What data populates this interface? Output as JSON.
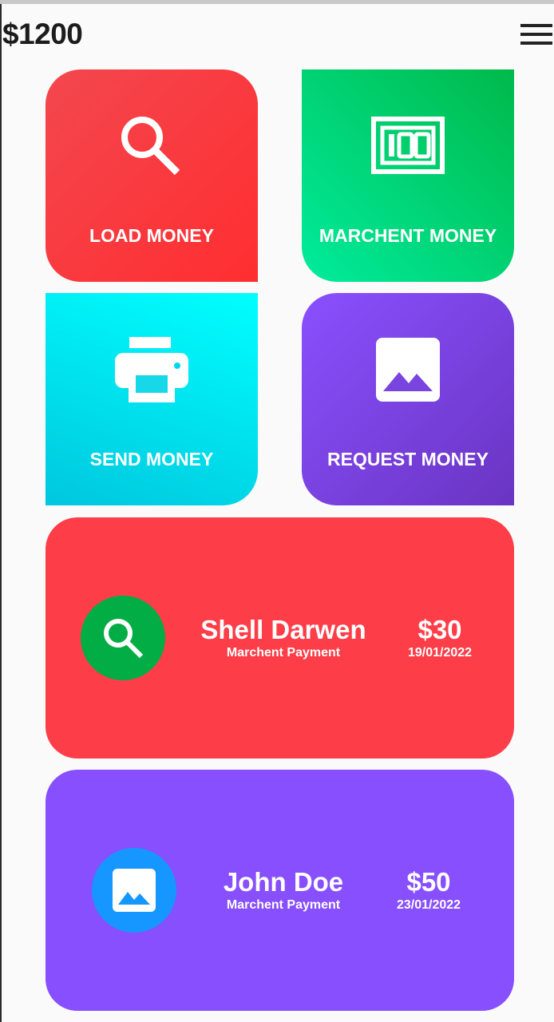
{
  "header": {
    "balance": "$1200",
    "menu_icon": "hamburger-menu-icon"
  },
  "tiles": [
    {
      "label": "LOAD MONEY",
      "icon": "search-icon",
      "color": "#f3474f"
    },
    {
      "label": "MARCHENT MONEY",
      "icon": "banknote-100-icon",
      "color": "#00c96b"
    },
    {
      "label": "SEND MONEY",
      "icon": "printer-icon",
      "color": "#00e0ef"
    },
    {
      "label": "REQUEST MONEY",
      "icon": "image-icon",
      "color": "#7b42e8"
    }
  ],
  "transactions": [
    {
      "name": "Shell Darwen",
      "type": "Marchent Payment",
      "amount": "$30",
      "date": "19/01/2022",
      "icon": "search-icon",
      "card_color": "#fd3e48",
      "avatar_color": "#01ad44"
    },
    {
      "name": "John Doe",
      "type": "Marchent Payment",
      "amount": "$50",
      "date": "23/01/2022",
      "icon": "image-icon",
      "card_color": "#874ffd",
      "avatar_color": "#1597ff"
    }
  ]
}
